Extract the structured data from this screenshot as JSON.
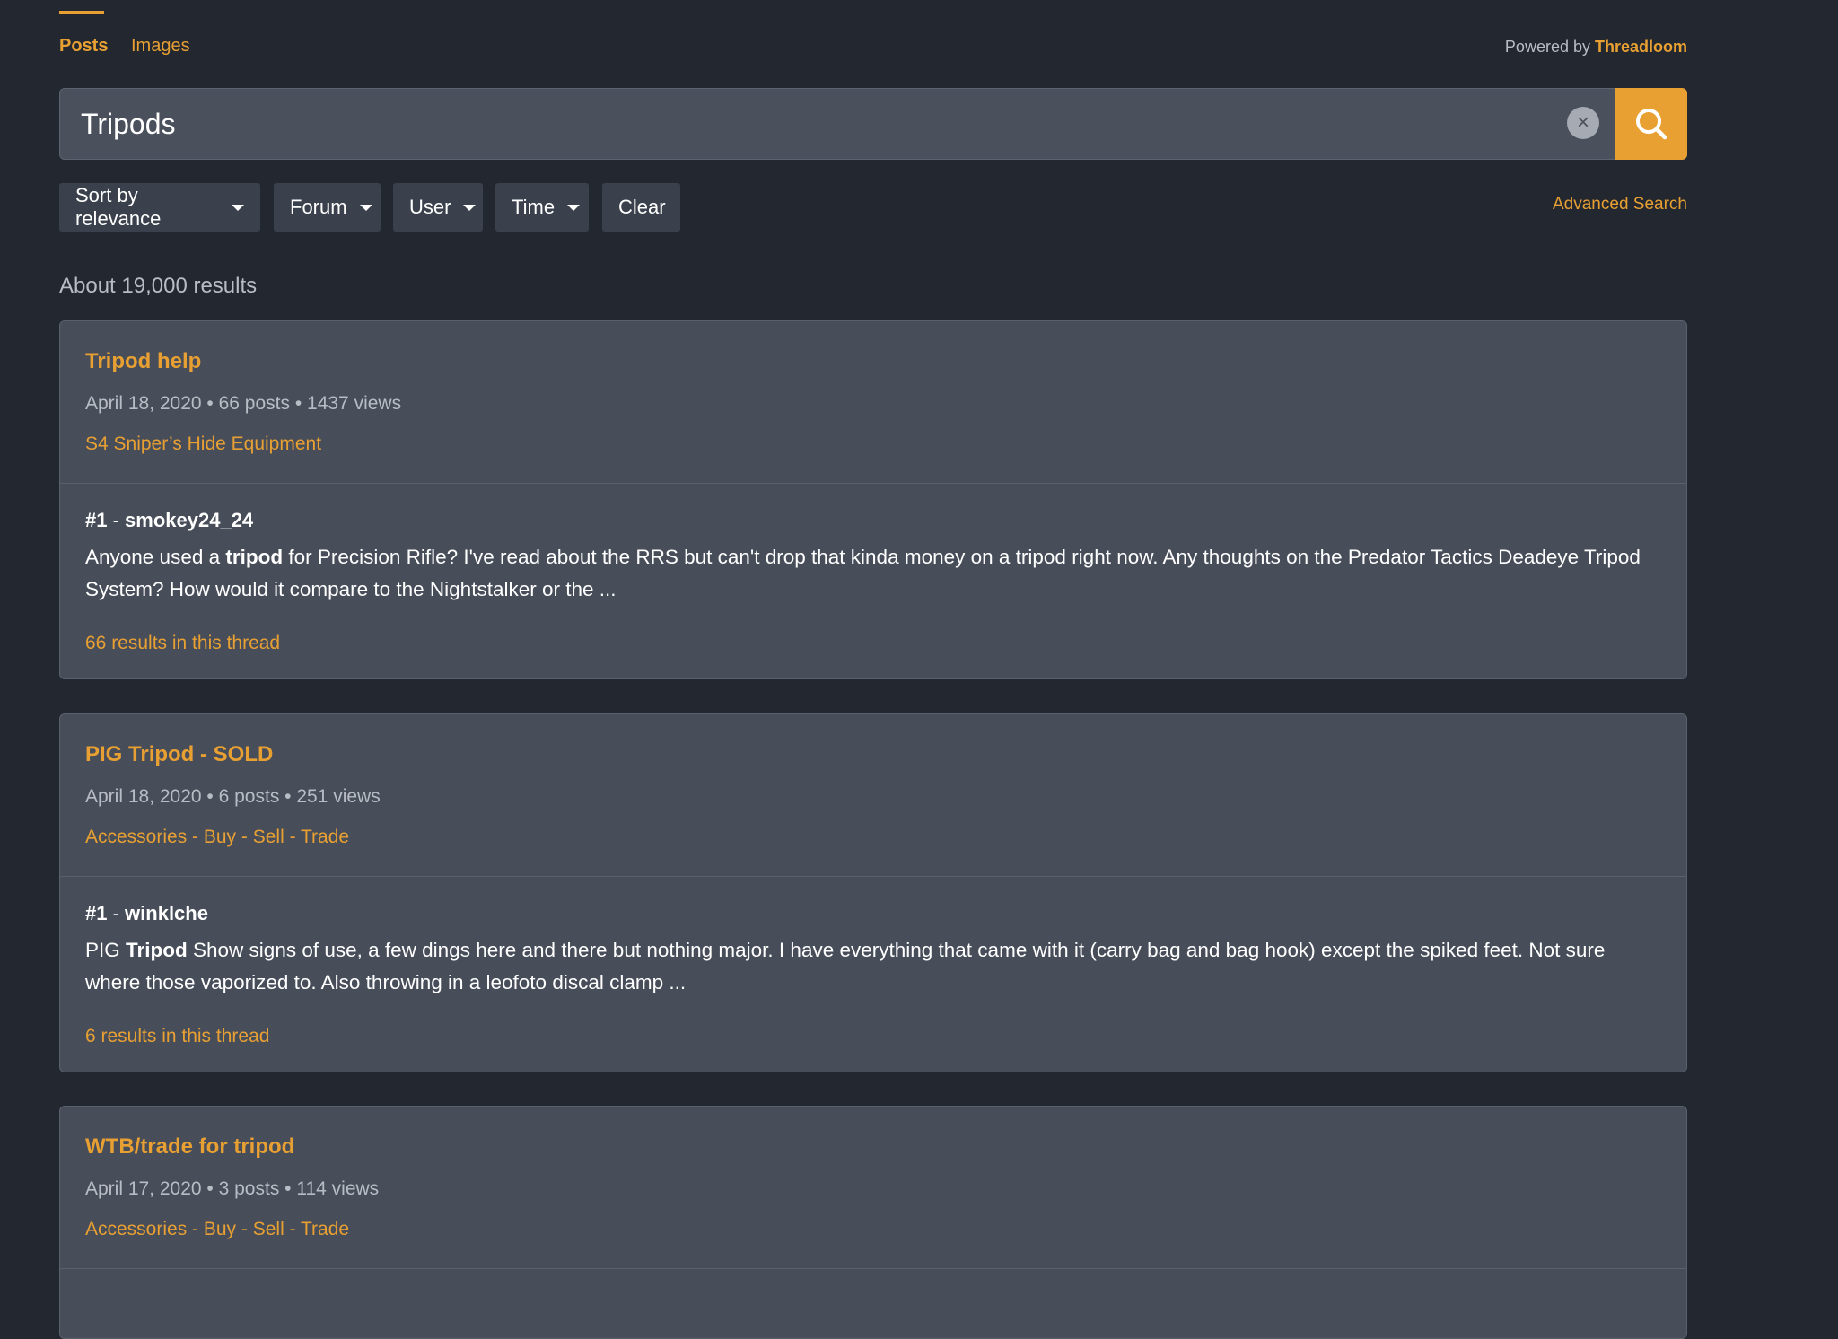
{
  "tabs": [
    {
      "label": "Posts",
      "active": true
    },
    {
      "label": "Images",
      "active": false
    }
  ],
  "powered_by": {
    "prefix": "Powered by ",
    "brand": "Threadloom"
  },
  "search": {
    "value": "Tripods",
    "clear_icon": "close-icon",
    "submit_icon": "search-icon"
  },
  "filters": {
    "sort": "Sort by relevance",
    "forum": "Forum",
    "user": "User",
    "time": "Time",
    "clear": "Clear",
    "advanced": "Advanced Search"
  },
  "results_count": "About 19,000 results",
  "results": [
    {
      "title": "Tripod help",
      "meta": "April 18, 2020 • 66 posts • 1437 views",
      "forum": "S4 Sniper’s Hide Equipment",
      "post_num": "#1",
      "sep": " - ",
      "author": "smokey24_24",
      "text_before": "Anyone used a ",
      "text_bold": "tripod",
      "text_after": " for Precision Rifle? I've read about the RRS but can't drop that kinda money on a tripod right now. Any thoughts on the Predator Tactics Deadeye Tripod System? How would it compare to the Nightstalker or the ...",
      "thread_results": "66 results in this thread"
    },
    {
      "title": "PIG Tripod - SOLD",
      "meta": "April 18, 2020 • 6 posts • 251 views",
      "forum": "Accessories - Buy - Sell - Trade",
      "post_num": "#1",
      "sep": " - ",
      "author": "winklche",
      "text_before": "PIG ",
      "text_bold": "Tripod",
      "text_after": " Show signs of use, a few dings here and there but nothing major. I have everything that came with it (carry bag and bag hook) except the spiked feet. Not sure where those vaporized to. Also throwing in a leofoto discal clamp ...",
      "thread_results": "6 results in this thread"
    },
    {
      "title": "WTB/trade for tripod",
      "meta": "April 17, 2020 • 3 posts • 114 views",
      "forum": "Accessories - Buy - Sell - Trade"
    }
  ],
  "colors": {
    "accent": "#e8a033",
    "background": "#23272f",
    "card": "#474d59"
  }
}
